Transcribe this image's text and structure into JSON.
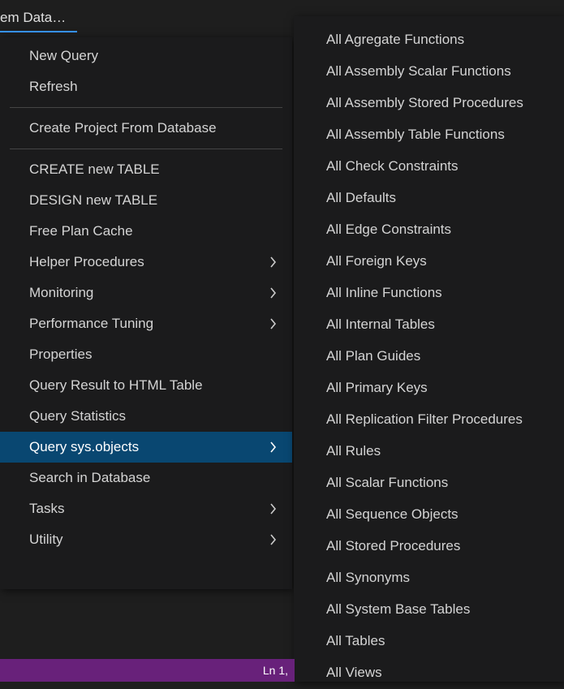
{
  "tab": {
    "label": "em Data…"
  },
  "menu": {
    "group1": [
      {
        "label": "New Query",
        "submenu": false
      },
      {
        "label": "Refresh",
        "submenu": false
      }
    ],
    "group2": [
      {
        "label": "Create Project From Database",
        "submenu": false
      }
    ],
    "group3": [
      {
        "label": "CREATE new TABLE",
        "submenu": false
      },
      {
        "label": "DESIGN new TABLE",
        "submenu": false
      },
      {
        "label": "Free Plan Cache",
        "submenu": false
      },
      {
        "label": "Helper Procedures",
        "submenu": true
      },
      {
        "label": "Monitoring",
        "submenu": true
      },
      {
        "label": "Performance Tuning",
        "submenu": true
      },
      {
        "label": "Properties",
        "submenu": false
      },
      {
        "label": "Query Result to HTML Table",
        "submenu": false
      },
      {
        "label": "Query Statistics",
        "submenu": false
      },
      {
        "label": "Query sys.objects",
        "submenu": true,
        "selected": true
      },
      {
        "label": "Search in Database",
        "submenu": false
      },
      {
        "label": "Tasks",
        "submenu": true
      },
      {
        "label": "Utility",
        "submenu": true
      }
    ]
  },
  "submenu": {
    "items": [
      "All Agregate Functions",
      "All Assembly Scalar Functions",
      "All Assembly Stored Procedures",
      "All Assembly Table Functions",
      "All Check Constraints",
      "All Defaults",
      "All Edge Constraints",
      "All Foreign Keys",
      "All Inline Functions",
      "All Internal Tables",
      "All Plan Guides",
      "All Primary Keys",
      "All Replication Filter Procedures",
      "All Rules",
      "All Scalar Functions",
      "All Sequence Objects",
      "All Stored Procedures",
      "All Synonyms",
      "All System Base Tables",
      "All Tables",
      "All Views"
    ]
  },
  "statusbar": {
    "position": "Ln 1,"
  }
}
